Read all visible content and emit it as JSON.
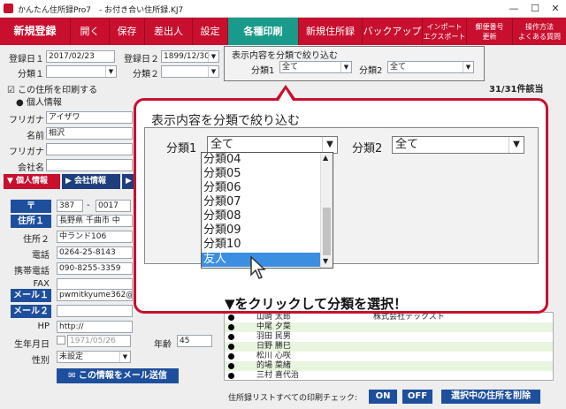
{
  "window": {
    "app_title": "かんたん住所録Pro7",
    "doc_title": "- お付き合い住所録.KJ7",
    "min": "—",
    "max": "☐",
    "close": "✕"
  },
  "toolbar": {
    "new_entry": "新規登録",
    "open": "開く",
    "save": "保存",
    "sender": "差出人",
    "settings": "設定",
    "print": "各種印刷",
    "new_address_book": "新規住所録",
    "backup": "バックアップ",
    "import1": "インポート",
    "import2": "エクスポート",
    "postal1": "郵便番号",
    "postal2": "更新",
    "help1": "操作方法",
    "help2": "よくある質問"
  },
  "form": {
    "reg_date1_label": "登録日１",
    "reg_date1_value": "2017/02/23",
    "reg_date2_label": "登録日２",
    "reg_date2_value": "1899/12/30",
    "cat1_label": "分類１",
    "cat2_label": "分類２",
    "print_check_label": "☑ この住所を印刷する",
    "personal_radio": "● 個人情報",
    "furigana_label": "フリガナ",
    "furigana_value": "アイザワ",
    "name_label": "名前",
    "name_value": "相沢",
    "furigana2_label": "フリガナ",
    "company_label": "会社名",
    "tab_personal": "▼ 個人情報",
    "tab_company": "▶ 会社情報",
    "tab_other": "▶",
    "postal_button": "〒",
    "postal1": "387",
    "postal_dash": "-",
    "postal2": "0017",
    "address1_button": "住所１",
    "address1_value": "長野県 千曲市 中",
    "address2_label": "住所２",
    "address2_value": "中ランド106",
    "phone_label": "電話",
    "phone_value": "0264-25-8143",
    "mobile_label": "携帯電話",
    "mobile_value": "090-8255-3359",
    "fax_label": "FAX",
    "mail1_button": "メール１",
    "mail1_value": "pwmitkyume362@",
    "mail2_button": "メール２",
    "hp_label": "HP",
    "hp_value": "http://",
    "birthday_label": "生年月日",
    "birthday_value": "1971/05/26",
    "age_label": "年齢",
    "age_value": "45",
    "gender_label": "性別",
    "gender_value": "未設定",
    "send_mail_button": "✉ この情報をメール送信"
  },
  "filter": {
    "legend": "表示内容を分類で絞り込む",
    "cat1_label": "分類1",
    "cat1_value": "全て",
    "cat2_label": "分類2",
    "cat2_value": "全て"
  },
  "count": "31/31件該当",
  "list_rows": [
    {
      "name": "山崎 太郎",
      "company": "株式会社テックスト"
    },
    {
      "name": "中尾 夕菜",
      "company": ""
    },
    {
      "name": "羽田 民男",
      "company": ""
    },
    {
      "name": "日野 勝巳",
      "company": ""
    },
    {
      "name": "松川 心咲",
      "company": ""
    },
    {
      "name": "的場 菜緒",
      "company": ""
    },
    {
      "name": "三村 喜代治",
      "company": ""
    }
  ],
  "footer": {
    "label": "住所録リストすべての印刷チェック:",
    "on": "ON",
    "off": "OFF",
    "delete": "選択中の住所を削除"
  },
  "callout": {
    "legend": "表示内容を分類で絞り込む",
    "cat1_label": "分類1",
    "cat1_value": "全て",
    "cat2_label": "分類2",
    "cat2_value": "全て",
    "dropdown_items": [
      "分類04",
      "分類05",
      "分類06",
      "分類07",
      "分類08",
      "分類09",
      "分類10",
      "友人"
    ],
    "selected_item": "友人",
    "instruction": "▼をクリックして分類を選択！"
  }
}
